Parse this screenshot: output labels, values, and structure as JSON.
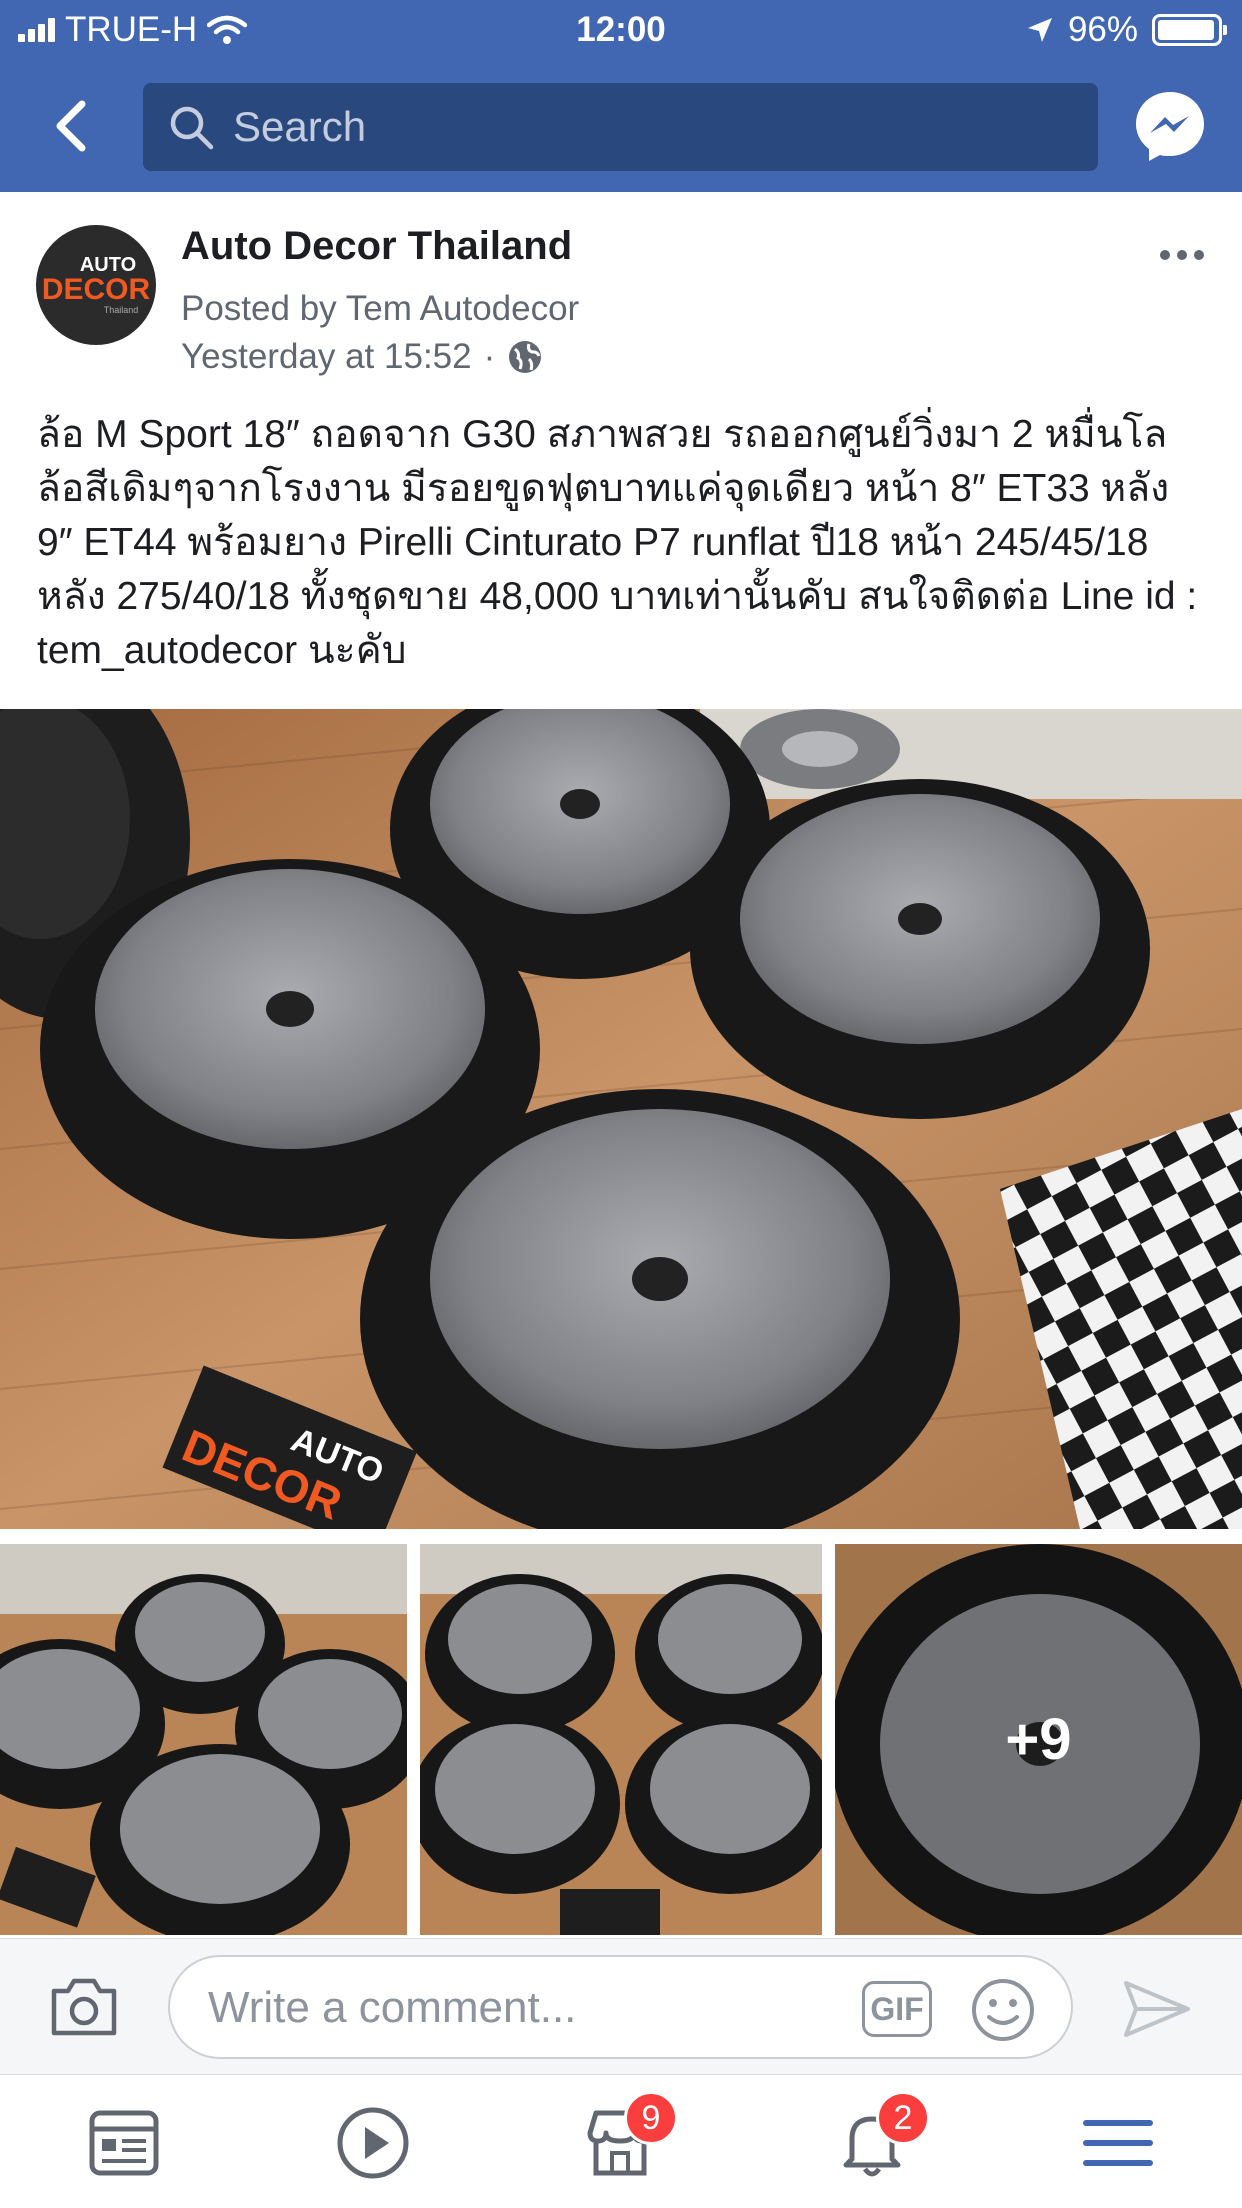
{
  "status_bar": {
    "carrier": "TRUE-H",
    "time": "12:00",
    "battery": "96%",
    "battery_level": 0.96
  },
  "nav": {
    "search_placeholder": "Search",
    "back_icon": "chevron-left-icon",
    "messenger_icon": "messenger-icon"
  },
  "post": {
    "page_name": "Auto Decor Thailand",
    "posted_by": "Posted by Tem Autodecor",
    "time": "Yesterday at 15:52",
    "separator": "·",
    "privacy_icon": "globe-icon",
    "avatar_logo": {
      "line1": "AUTO",
      "line2": "DECOR",
      "line3": "Thailand"
    },
    "text": "ล้อ M Sport 18″ ถอดจาก G30 สภาพสวย รถออกศูนย์วิ่งมา 2 หมื่นโล ล้อสีเดิมๆจากโรงงาน มีรอยขูดฟุตบาทแค่จุดเดียว หน้า 8″ ET33 หลัง 9″ ET44 พร้อมยาง Pirelli Cinturato P7 runflat ปี18 หน้า 245/45/18 หลัง 275/40/18 ทั้งชุดขาย 48,000 บาทเท่านั้นคับ สนใจติดต่อ Line id : tem_autodecor นะคับ",
    "more_photos": "+9",
    "watermark": {
      "line1": "AUTO",
      "line2": "DECOR"
    }
  },
  "comment_bar": {
    "placeholder": "Write a comment...",
    "gif_label": "GIF"
  },
  "tab_bar": {
    "items": [
      {
        "name": "news-feed",
        "icon": "newsfeed-icon",
        "badge": ""
      },
      {
        "name": "watch",
        "icon": "play-icon",
        "badge": ""
      },
      {
        "name": "marketplace",
        "icon": "marketplace-icon",
        "badge": "9"
      },
      {
        "name": "notifications",
        "icon": "bell-icon",
        "badge": "2"
      },
      {
        "name": "menu",
        "icon": "menu-icon",
        "badge": ""
      }
    ]
  },
  "colors": {
    "facebook_blue": "#4267b2",
    "search_bg": "#29487d",
    "badge_red": "#fa3e3e",
    "secondary_text": "#606770",
    "floor_wood": "#c08a5d",
    "wheel_gray": "#8b8d91"
  }
}
